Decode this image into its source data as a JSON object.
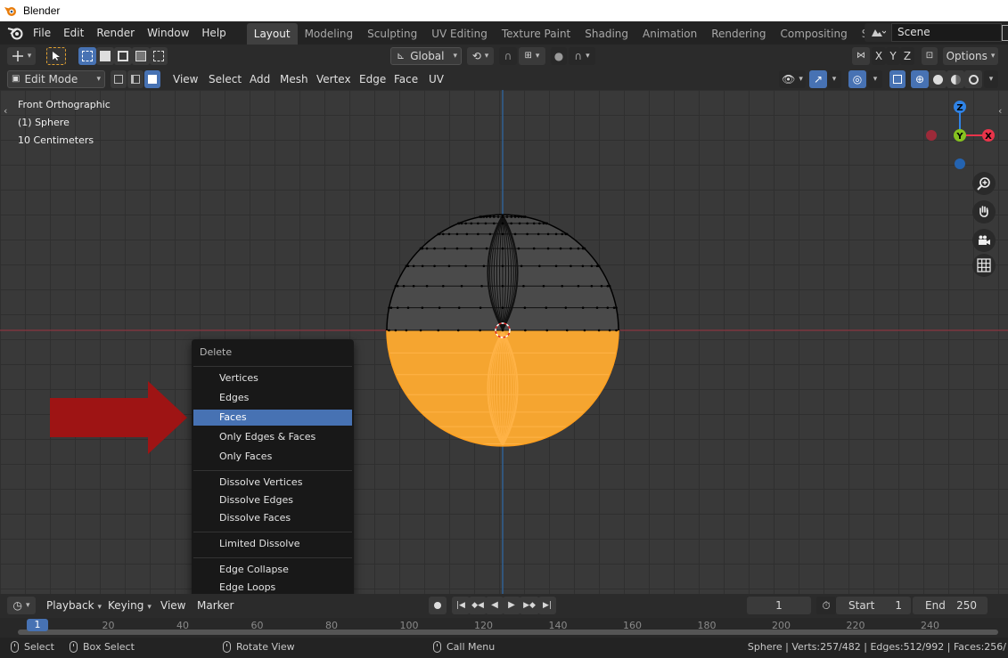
{
  "window": {
    "title": "Blender"
  },
  "topbar": {
    "menus": [
      "File",
      "Edit",
      "Render",
      "Window",
      "Help"
    ],
    "workspaces": [
      "Layout",
      "Modeling",
      "Sculpting",
      "UV Editing",
      "Texture Paint",
      "Shading",
      "Animation",
      "Rendering",
      "Compositing",
      "Scripting"
    ],
    "active_workspace": "Layout",
    "add_workspace": "+",
    "scene_name": "Scene"
  },
  "toolheader": {
    "orientation": "Global",
    "axes": [
      "X",
      "Y",
      "Z"
    ],
    "options_label": "Options"
  },
  "vpheader": {
    "mode": "Edit Mode",
    "menus": [
      "View",
      "Select",
      "Add",
      "Mesh",
      "Vertex",
      "Edge",
      "Face",
      "UV"
    ]
  },
  "viewport": {
    "info": [
      "Front Orthographic",
      "(1) Sphere",
      "10 Centimeters"
    ],
    "gizmo": {
      "z": "Z",
      "y": "Y",
      "x": "X"
    },
    "colors": {
      "selected": "#f5a530",
      "x_axis": "#e8344a",
      "y_axis": "#86c220",
      "z_axis": "#2f83e6",
      "highlight": "#4772b3"
    }
  },
  "delete_menu": {
    "title": "Delete",
    "groups": [
      [
        "Vertices",
        "Edges",
        "Faces",
        "Only Edges & Faces",
        "Only Faces"
      ],
      [
        "Dissolve Vertices",
        "Dissolve Edges",
        "Dissolve Faces"
      ],
      [
        "Limited Dissolve"
      ],
      [
        "Edge Collapse",
        "Edge Loops"
      ]
    ],
    "highlighted": "Faces"
  },
  "timeline": {
    "menus": [
      "Playback",
      "Keying",
      "View",
      "Marker"
    ],
    "current_frame": "1",
    "start_label": "Start",
    "start_value": "1",
    "end_label": "End",
    "end_value": "250",
    "ticks": [
      "1",
      "20",
      "40",
      "60",
      "80",
      "100",
      "120",
      "140",
      "160",
      "180",
      "200",
      "220",
      "240"
    ]
  },
  "statusbar": {
    "select": "Select",
    "box_select": "Box Select",
    "rotate_view": "Rotate View",
    "call_menu": "Call Menu",
    "stats": "Sphere | Verts:257/482 | Edges:512/992 | Faces:256/"
  }
}
